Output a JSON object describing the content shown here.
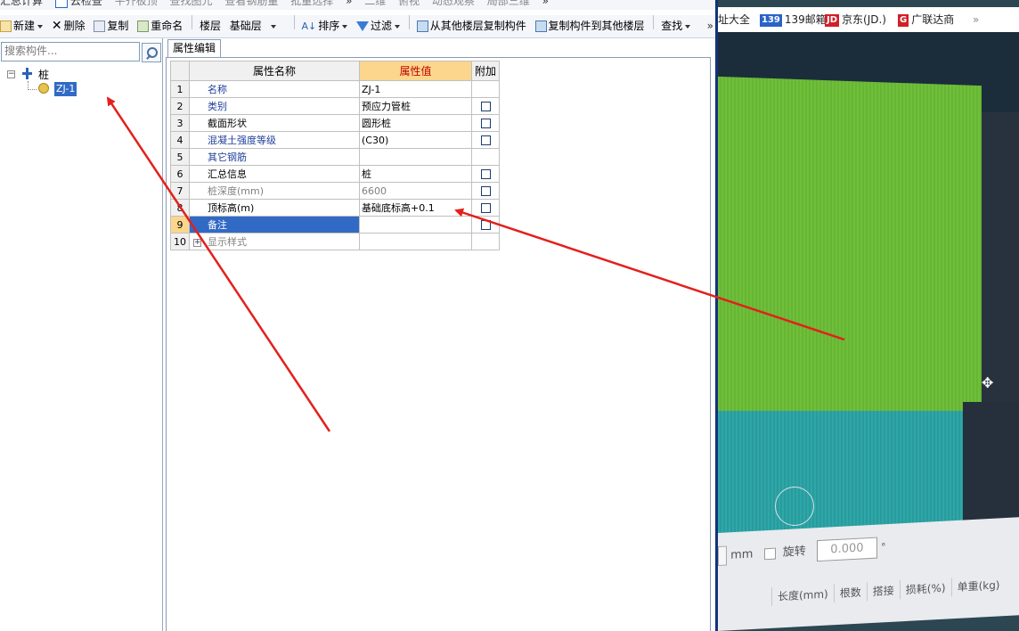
{
  "toolbar_top": {
    "items": [
      "汇总计算",
      "云检查",
      "平齐板顶",
      "查找图元",
      "查看钢筋量",
      "批量选择"
    ],
    "view_items": [
      "二维",
      "俯视",
      "动态观察",
      "局部三维"
    ],
    "more": "»"
  },
  "toolbar_main": {
    "new_label": "新建",
    "delete_label": "删除",
    "copy_label": "复制",
    "rename_label": "重命名",
    "floor_label": "楼层",
    "floor_value": "基础层",
    "sort_label": "排序",
    "filter_label": "过滤",
    "copy_from_floor_label": "从其他楼层复制构件",
    "copy_to_floor_label": "复制构件到其他楼层",
    "find_label": "查找",
    "more": "»"
  },
  "tree": {
    "search_placeholder": "搜索构件...",
    "root_label": "桩",
    "child_label": "ZJ-1"
  },
  "property_panel": {
    "tab_label": "属性编辑",
    "col_name": "属性名称",
    "col_value": "属性值",
    "col_extra": "附加",
    "rows": [
      {
        "num": "1",
        "name": "名称",
        "value": "ZJ-1"
      },
      {
        "num": "2",
        "name": "类别",
        "value": "预应力管桩"
      },
      {
        "num": "3",
        "name": "截面形状",
        "value": "圆形桩"
      },
      {
        "num": "4",
        "name": "混凝土强度等级",
        "value": "(C30)"
      },
      {
        "num": "5",
        "name": "其它钢筋",
        "value": ""
      },
      {
        "num": "6",
        "name": "汇总信息",
        "value": "桩"
      },
      {
        "num": "7",
        "name": "桩深度(mm)",
        "value": "6600"
      },
      {
        "num": "8",
        "name": "顶标高(m)",
        "value": "基础底标高+0.1"
      },
      {
        "num": "9",
        "name": "备注",
        "value": ""
      },
      {
        "num": "10",
        "name": "显示样式",
        "value": ""
      }
    ],
    "expander_symbol": "+"
  },
  "browser": {
    "bookmarks": [
      "址大全",
      "139邮箱",
      "京东(JD.)",
      "广联达商"
    ],
    "bookmark_icons": [
      "139",
      "JD",
      "G"
    ],
    "more": "»"
  },
  "view3d": {
    "unit_label": "mm",
    "rotate_label": "旋转",
    "rotate_value": "0.000",
    "degree_symbol": "°",
    "table_headers": [
      "长度(mm)",
      "根数",
      "搭接",
      "损耗(%)",
      "单重(kg)"
    ]
  },
  "colors": {
    "header_value_bg": "#fbd68c",
    "selection": "#316ac5",
    "annotation_arrow": "#e3201b",
    "green_face": "#6fbf3a",
    "teal_face": "#2fa6a8"
  }
}
